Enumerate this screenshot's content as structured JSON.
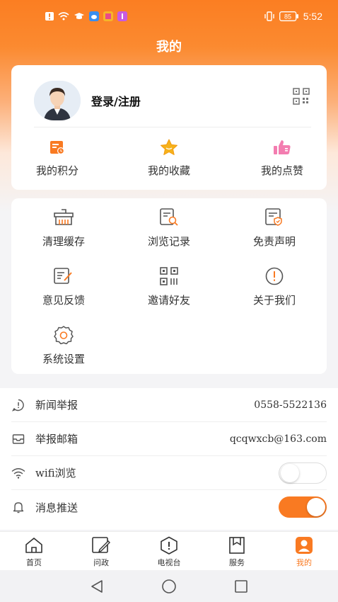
{
  "status_bar": {
    "time": "5:52",
    "battery": "85",
    "icons": [
      "notification-icon",
      "wifi-icon",
      "hat-icon",
      "app-icon",
      "app-icon",
      "app-icon",
      "vibrate-icon",
      "battery-icon"
    ]
  },
  "header": {
    "title": "我的"
  },
  "profile": {
    "login_label": "登录/注册",
    "stats": [
      {
        "label": "我的积分",
        "icon": "points-icon"
      },
      {
        "label": "我的收藏",
        "icon": "star-icon"
      },
      {
        "label": "我的点赞",
        "icon": "thumbs-up-icon"
      }
    ]
  },
  "tools": [
    {
      "label": "清理缓存",
      "icon": "broom-icon"
    },
    {
      "label": "浏览记录",
      "icon": "history-icon"
    },
    {
      "label": "免责声明",
      "icon": "disclaimer-icon"
    },
    {
      "label": "意见反馈",
      "icon": "feedback-icon"
    },
    {
      "label": "邀请好友",
      "icon": "qr-code-icon"
    },
    {
      "label": "关于我们",
      "icon": "info-icon"
    },
    {
      "label": "系统设置",
      "icon": "gear-icon"
    }
  ],
  "list": {
    "report": {
      "label": "新闻举报",
      "value": "0558-5522136",
      "icon": "report-icon"
    },
    "email": {
      "label": "举报邮箱",
      "value": "qcqwxcb@163.com",
      "icon": "mail-icon"
    },
    "wifi": {
      "label": "wifi浏览",
      "enabled": false,
      "icon": "wifi-icon"
    },
    "push": {
      "label": "消息推送",
      "enabled": true,
      "icon": "bell-icon"
    }
  },
  "tabs": [
    {
      "label": "首页",
      "icon": "home-icon",
      "active": false
    },
    {
      "label": "问政",
      "icon": "edit-icon",
      "active": false
    },
    {
      "label": "电视台",
      "icon": "tv-icon",
      "active": false
    },
    {
      "label": "服务",
      "icon": "bookmark-icon",
      "active": false
    },
    {
      "label": "我的",
      "icon": "profile-icon",
      "active": true
    }
  ],
  "colors": {
    "accent": "#f97a22",
    "text": "#333333",
    "background": "#f4f4f6"
  }
}
